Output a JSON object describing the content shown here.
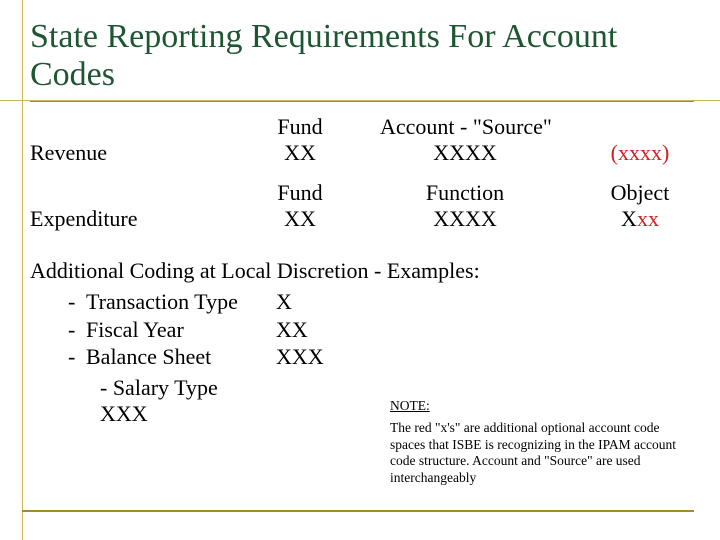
{
  "title": "State Reporting Requirements For Account Codes",
  "revenue": {
    "label": "Revenue",
    "headers": {
      "fund": "Fund",
      "account": "Account - \"Source\""
    },
    "values": {
      "fund": "XX",
      "account": "XXXX",
      "optional": "(xxxx)"
    }
  },
  "expenditure": {
    "label": "Expenditure",
    "headers": {
      "fund": "Fund",
      "function": "Function",
      "object": "Object"
    },
    "values": {
      "fund": "XX",
      "function": "XXXX",
      "object_prefix": "X",
      "object_suffix": "xx"
    }
  },
  "additional": {
    "heading": "Additional Coding at Local Discretion - Examples:",
    "items": [
      {
        "dash": "-",
        "label": "Transaction Type",
        "value": "X"
      },
      {
        "dash": "-",
        "label": " Fiscal Year",
        "value": "XX"
      },
      {
        "dash": "-",
        "label": " Balance Sheet",
        "value": "XXX"
      }
    ],
    "salary": {
      "label": "- Salary Type",
      "value": "XXX"
    }
  },
  "note": {
    "heading": "NOTE:",
    "body": "The red \"x's\" are additional optional account code spaces that ISBE is recognizing in the IPAM account code structure.  Account and \"Source\" are used interchangeably"
  }
}
